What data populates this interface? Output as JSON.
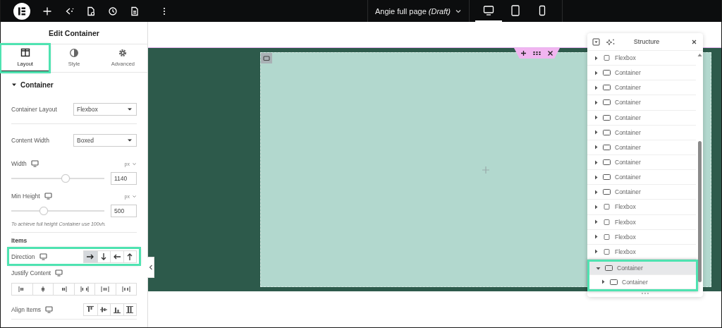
{
  "top_bar": {
    "document_title": "Angie full page *(Draft)*",
    "devices": [
      {
        "kind": "desktop",
        "selected": true
      },
      {
        "kind": "tablet",
        "selected": false
      },
      {
        "kind": "mobile",
        "selected": false
      }
    ]
  },
  "panel": {
    "title": "Edit Container",
    "tabs": [
      {
        "kind": "layout",
        "label": "Layout",
        "selected": true,
        "highlighted": true
      },
      {
        "kind": "style",
        "label": "Style",
        "selected": false,
        "highlighted": false
      },
      {
        "kind": "advanced",
        "label": "Advanced",
        "selected": false,
        "highlighted": false
      }
    ],
    "section": {
      "title": "Container",
      "expanded": true
    },
    "controls": [
      {
        "kind": "select",
        "label": "Container Layout",
        "value": "Flexbox"
      },
      {
        "kind": "divider"
      },
      {
        "kind": "select",
        "label": "Content Width",
        "value": "Boxed"
      },
      {
        "kind": "slider",
        "label": "Width",
        "unit": "px",
        "level": 0.58,
        "value": "1140"
      },
      {
        "kind": "slider",
        "label": "Min Height",
        "unit": "px",
        "level": 0.35,
        "value": "500"
      },
      {
        "kind": "note",
        "text": "To achieve full height Container use 100vh."
      },
      {
        "kind": "divider"
      },
      {
        "kind": "heading",
        "text": "Items"
      },
      {
        "kind": "direction",
        "label": "Direction",
        "highlighted": true,
        "options": [
          {
            "selected": true
          },
          {
            "selected": false
          },
          {
            "selected": false
          },
          {
            "selected": false
          }
        ]
      },
      {
        "kind": "justify",
        "label": "Justify Content",
        "options": [
          {
            "selected": false
          },
          {
            "selected": false
          },
          {
            "selected": false
          },
          {
            "selected": false
          },
          {
            "selected": false
          },
          {
            "selected": false
          }
        ]
      },
      {
        "kind": "align",
        "label": "Align Items",
        "options": [
          {
            "selected": false
          },
          {
            "selected": false
          },
          {
            "selected": false
          },
          {
            "selected": false
          }
        ]
      },
      {
        "kind": "divider"
      }
    ]
  },
  "structure": {
    "title": "Structure",
    "items": [
      {
        "kind": "flexbox",
        "label": "Flexbox",
        "expanded": false,
        "selected": false,
        "highlighted": false
      },
      {
        "kind": "container",
        "label": "Container",
        "expanded": false,
        "selected": false,
        "highlighted": false
      },
      {
        "kind": "container",
        "label": "Container",
        "expanded": false,
        "selected": false,
        "highlighted": false
      },
      {
        "kind": "container",
        "label": "Container",
        "expanded": false,
        "selected": false,
        "highlighted": false
      },
      {
        "kind": "container",
        "label": "Container",
        "expanded": false,
        "selected": false,
        "highlighted": false
      },
      {
        "kind": "container",
        "label": "Container",
        "expanded": false,
        "selected": false,
        "highlighted": false
      },
      {
        "kind": "container",
        "label": "Container",
        "expanded": false,
        "selected": false,
        "highlighted": false
      },
      {
        "kind": "container",
        "label": "Container",
        "expanded": false,
        "selected": false,
        "highlighted": false
      },
      {
        "kind": "container",
        "label": "Container",
        "expanded": false,
        "selected": false,
        "highlighted": false
      },
      {
        "kind": "container",
        "label": "Container",
        "expanded": false,
        "selected": false,
        "highlighted": false
      },
      {
        "kind": "flexbox",
        "label": "Flexbox",
        "expanded": false,
        "selected": false,
        "highlighted": false
      },
      {
        "kind": "flexbox",
        "label": "Flexbox",
        "expanded": false,
        "selected": false,
        "highlighted": false
      },
      {
        "kind": "flexbox",
        "label": "Flexbox",
        "expanded": false,
        "selected": false,
        "highlighted": false
      },
      {
        "kind": "flexbox",
        "label": "Flexbox",
        "expanded": false,
        "selected": false,
        "highlighted": false
      },
      {
        "kind": "container",
        "label": "Container",
        "expanded": true,
        "selected": true,
        "highlighted": true,
        "children": [
          {
            "kind": "container",
            "label": "Container",
            "expanded": false,
            "selected": false,
            "highlighted": false
          }
        ]
      }
    ]
  }
}
